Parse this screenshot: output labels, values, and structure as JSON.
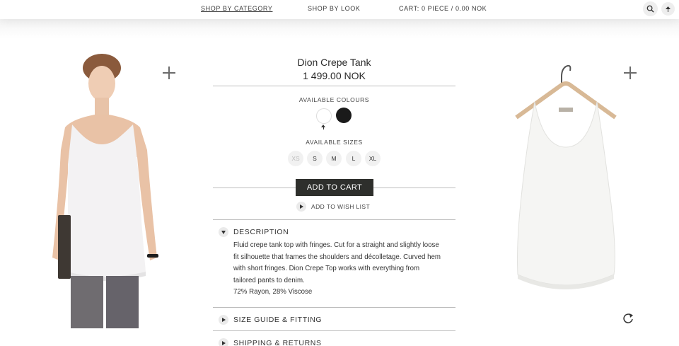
{
  "nav": {
    "links": [
      "SHOP BY CATEGORY",
      "SHOP BY LOOK",
      "CART: 0 PIECE / 0.00 NOK"
    ],
    "icons": [
      "search-icon",
      "arrow-up-icon"
    ]
  },
  "product": {
    "name": "Dion Crepe Tank",
    "price": "1 499.00 NOK",
    "colours_label": "AVAILABLE COLOURS",
    "colours": [
      "#ffffff",
      "#1a1a1a"
    ],
    "selected_colour": "white",
    "sizes_label": "AVAILABLE SIZES",
    "sizes": [
      "XS",
      "S",
      "M",
      "L",
      "XL"
    ],
    "unavailable_sizes": [
      "XS"
    ],
    "add_to_cart": "ADD TO CART",
    "wish_list": "ADD TO WISH LIST"
  },
  "accordion": {
    "description_title": "DESCRIPTION",
    "description_lines": [
      "Fluid crepe tank top with fringes. Cut for a straight and slightly loose",
      "fit silhouette that frames the shoulders and décolletage. Curved hem",
      "with short fringes. Dion Crepe Top works with everything from",
      "tailored pants to denim.",
      "72% Rayon, 28% Viscose"
    ],
    "size_guide_title": "SIZE GUIDE & FITTING",
    "shipping_title": "SHIPPING & RETURNS"
  },
  "images": {
    "model_photo": "model-wearing-tank-photo",
    "hanger_photo": "tank-on-hanger-photo",
    "zoom_icon": "plus-icon",
    "rotate_icon": "rotate-icon"
  }
}
